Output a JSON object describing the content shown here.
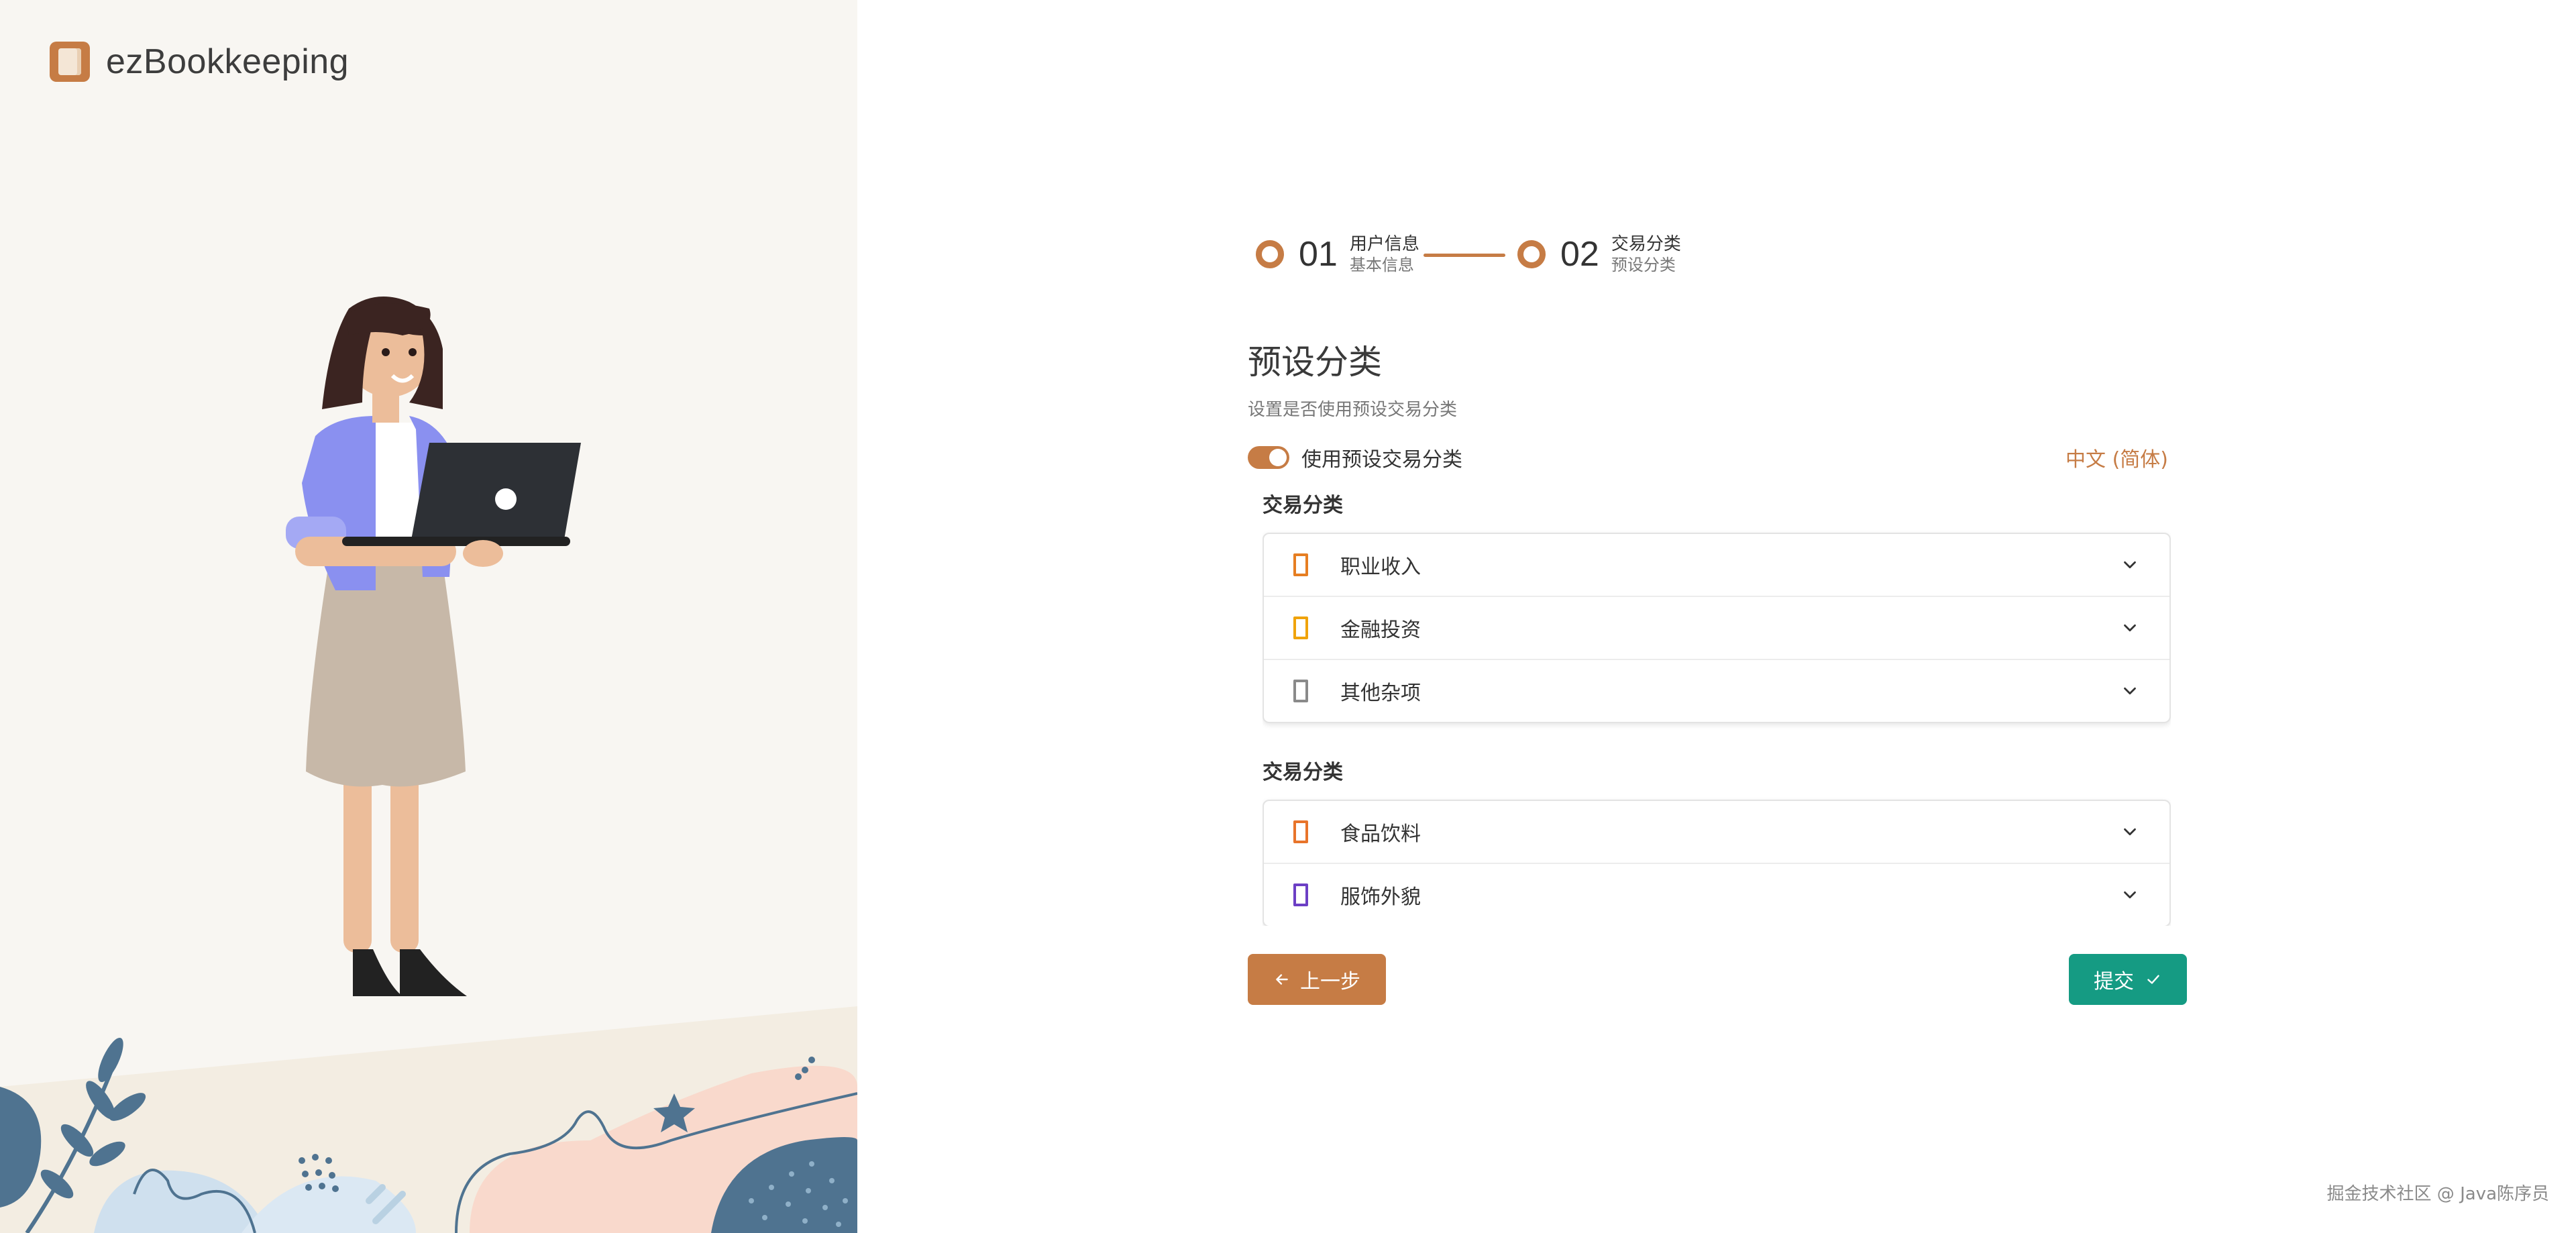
{
  "brand": {
    "name": "ezBookkeeping",
    "icon": "book-icon",
    "color": "#c67c45"
  },
  "stepper": {
    "steps": [
      {
        "number": "01",
        "title": "用户信息",
        "subtitle": "基本信息"
      },
      {
        "number": "02",
        "title": "交易分类",
        "subtitle": "预设分类"
      }
    ],
    "accent": "#c67c45"
  },
  "page": {
    "title": "预设分类",
    "description": "设置是否使用预设交易分类"
  },
  "toggle": {
    "label": "使用预设交易分类",
    "on": true
  },
  "language": {
    "label": "中文 (简体)"
  },
  "sections": [
    {
      "title": "交易分类",
      "items": [
        {
          "label": "职业收入",
          "icon_color": "#e67e22"
        },
        {
          "label": "金融投资",
          "icon_color": "#f0a30a"
        },
        {
          "label": "其他杂项",
          "icon_color": "#8a8a8a"
        }
      ]
    },
    {
      "title": "交易分类",
      "items": [
        {
          "label": "食品饮料",
          "icon_color": "#e8742a"
        },
        {
          "label": "服饰外貌",
          "icon_color": "#6c3fc5"
        }
      ]
    }
  ],
  "buttons": {
    "prev": "上一步",
    "submit": "提交"
  },
  "colors": {
    "primary": "#c67c45",
    "submit": "#159b83"
  },
  "watermark": "掘金技术社区 @ Java陈序员"
}
